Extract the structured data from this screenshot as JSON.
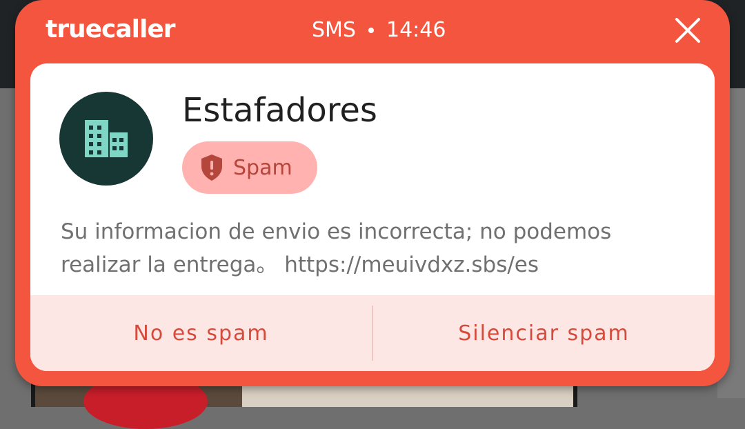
{
  "header": {
    "brand": "truecaller",
    "channel": "SMS",
    "time": "14:46"
  },
  "sender": {
    "name": "Estafadores",
    "badge_label": "Spam",
    "avatar_icon": "building-icon"
  },
  "message": {
    "text": "Su informacion de envio es incorrecta; no podemos realizar la entrega。 https://meuivdxz.sbs/es"
  },
  "actions": {
    "not_spam": "No es spam",
    "mute_spam": "Silenciar spam"
  },
  "colors": {
    "brand_red": "#f4553f",
    "avatar_bg": "#163733",
    "avatar_icon": "#7fd6c4",
    "badge_bg": "#ffb2b0",
    "badge_text": "#b4463b",
    "action_text": "#d64a3c",
    "action_bg": "#fde7e5"
  }
}
